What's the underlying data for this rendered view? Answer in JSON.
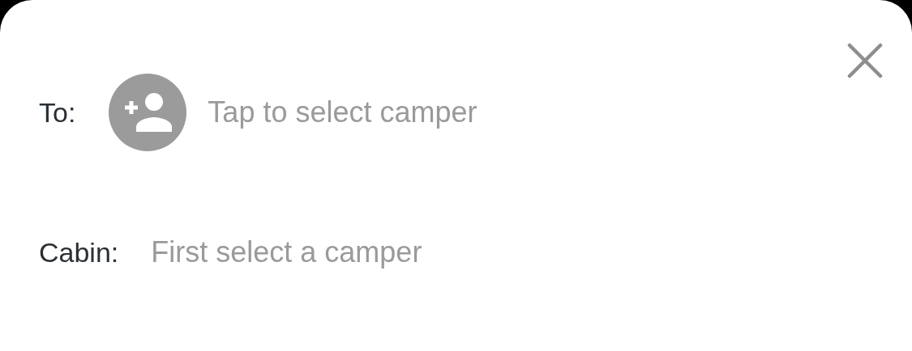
{
  "to": {
    "label": "To:",
    "placeholder": "Tap to select camper"
  },
  "cabin": {
    "label": "Cabin:",
    "placeholder": "First select a camper"
  }
}
